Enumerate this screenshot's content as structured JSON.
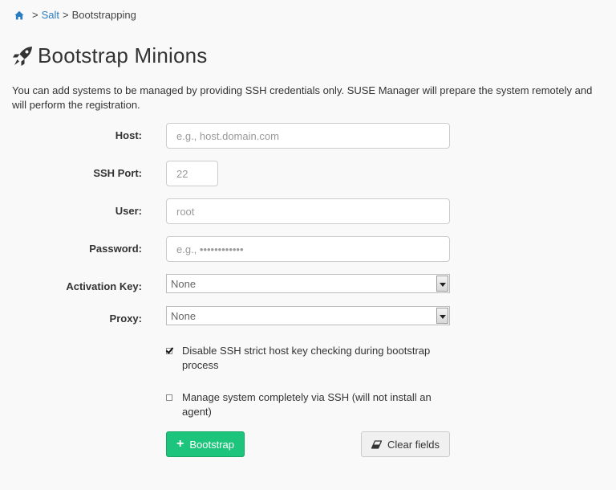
{
  "breadcrumb": {
    "home_icon": "home-icon",
    "separator": ">",
    "items": [
      "Salt",
      "Bootstrapping"
    ]
  },
  "page": {
    "title": "Bootstrap Minions",
    "title_icon": "rocket-icon",
    "description": "You can add systems to be managed by providing SSH credentials only. SUSE Manager will prepare the system remotely and will perform the registration."
  },
  "form": {
    "host": {
      "label": "Host:",
      "value": "",
      "placeholder": "e.g., host.domain.com"
    },
    "ssh_port": {
      "label": "SSH Port:",
      "value": "",
      "placeholder": "22"
    },
    "user": {
      "label": "User:",
      "value": "",
      "placeholder": "root"
    },
    "password": {
      "label": "Password:",
      "value": "",
      "placeholder": "e.g., ••••••••••••"
    },
    "activation_key": {
      "label": "Activation Key:",
      "selected": "None"
    },
    "proxy": {
      "label": "Proxy:",
      "selected": "None"
    },
    "disable_strict_key": {
      "label": "Disable SSH strict host key checking during bootstrap process",
      "checked": true
    },
    "manage_via_ssh": {
      "label": "Manage system completely via SSH (will not install an agent)",
      "checked": false
    }
  },
  "actions": {
    "bootstrap_label": "Bootstrap",
    "clear_label": "Clear fields"
  },
  "colors": {
    "link": "#2a7cc0",
    "primary": "#1dc47b"
  }
}
